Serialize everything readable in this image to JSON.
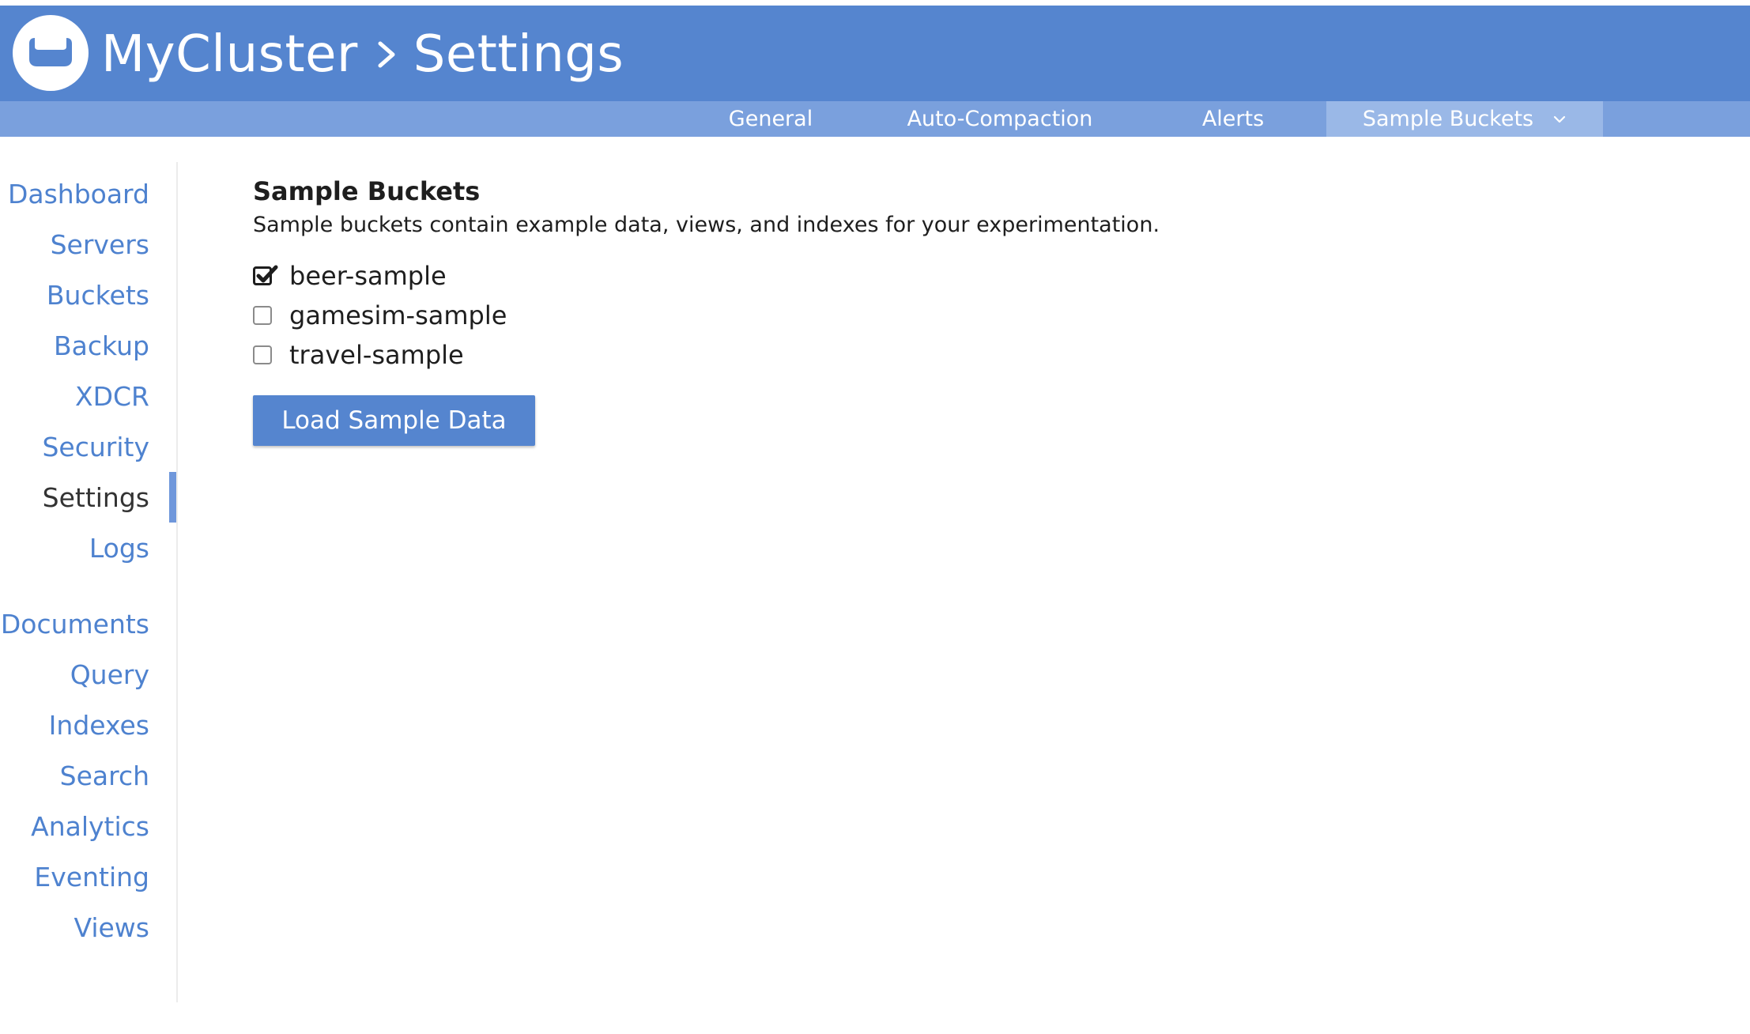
{
  "header": {
    "cluster_name": "MyCluster",
    "page_title": "Settings",
    "background_color": "#5585cf"
  },
  "subnav": {
    "tabs": [
      {
        "label": "General",
        "active": false
      },
      {
        "label": "Auto-Compaction",
        "active": false
      },
      {
        "label": "Alerts",
        "active": false
      },
      {
        "label": "Sample Buckets",
        "active": true
      }
    ]
  },
  "sidebar": {
    "items": [
      {
        "label": "Dashboard",
        "active": false
      },
      {
        "label": "Servers",
        "active": false
      },
      {
        "label": "Buckets",
        "active": false
      },
      {
        "label": "Backup",
        "active": false
      },
      {
        "label": "XDCR",
        "active": false
      },
      {
        "label": "Security",
        "active": false
      },
      {
        "label": "Settings",
        "active": true
      },
      {
        "label": "Logs",
        "active": false
      },
      {
        "label": "Documents",
        "active": false
      },
      {
        "label": "Query",
        "active": false
      },
      {
        "label": "Indexes",
        "active": false
      },
      {
        "label": "Search",
        "active": false
      },
      {
        "label": "Analytics",
        "active": false
      },
      {
        "label": "Eventing",
        "active": false
      },
      {
        "label": "Views",
        "active": false
      }
    ],
    "link_color": "#4e82cf",
    "active_color": "#333333"
  },
  "main": {
    "title": "Sample Buckets",
    "description": "Sample buckets contain example data, views, and indexes for your experimentation.",
    "buckets": [
      {
        "label": "beer-sample",
        "checked": true
      },
      {
        "label": "gamesim-sample",
        "checked": false
      },
      {
        "label": "travel-sample",
        "checked": false
      }
    ],
    "load_button_label": "Load Sample Data"
  }
}
